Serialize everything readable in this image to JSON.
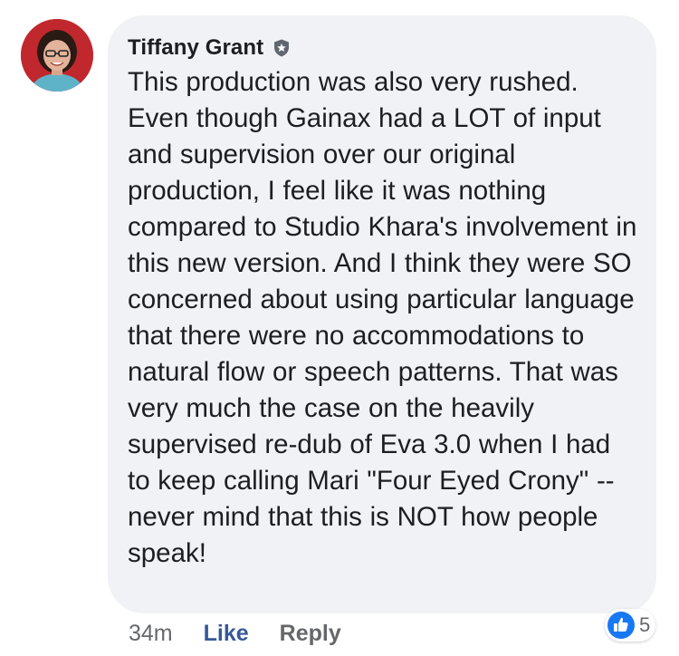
{
  "comment": {
    "author": "Tiffany Grant",
    "badge_icon": "top-fan-shield-icon",
    "text": "This production was also very rushed. Even though Gainax had a LOT of input and supervision over our original production, I feel like it was nothing compared to Studio Khara's involvement in this new version. And I think they were SO concerned about using particular language that there were no accommodations to natural flow or speech patterns. That was very much the case on the heavily supervised re-dub of Eva 3.0 when I had to keep calling Mari \"Four Eyed Crony\" -- never mind that this is NOT how people speak!",
    "timestamp": "34m",
    "like_label": "Like",
    "reply_label": "Reply",
    "reaction_count": "5",
    "reaction_icon": "like-thumb-icon"
  },
  "colors": {
    "bubble_bg": "#f0f2f5",
    "link_blue": "#385898",
    "meta_gray": "#65676b",
    "reaction_blue": "#1877f2"
  }
}
